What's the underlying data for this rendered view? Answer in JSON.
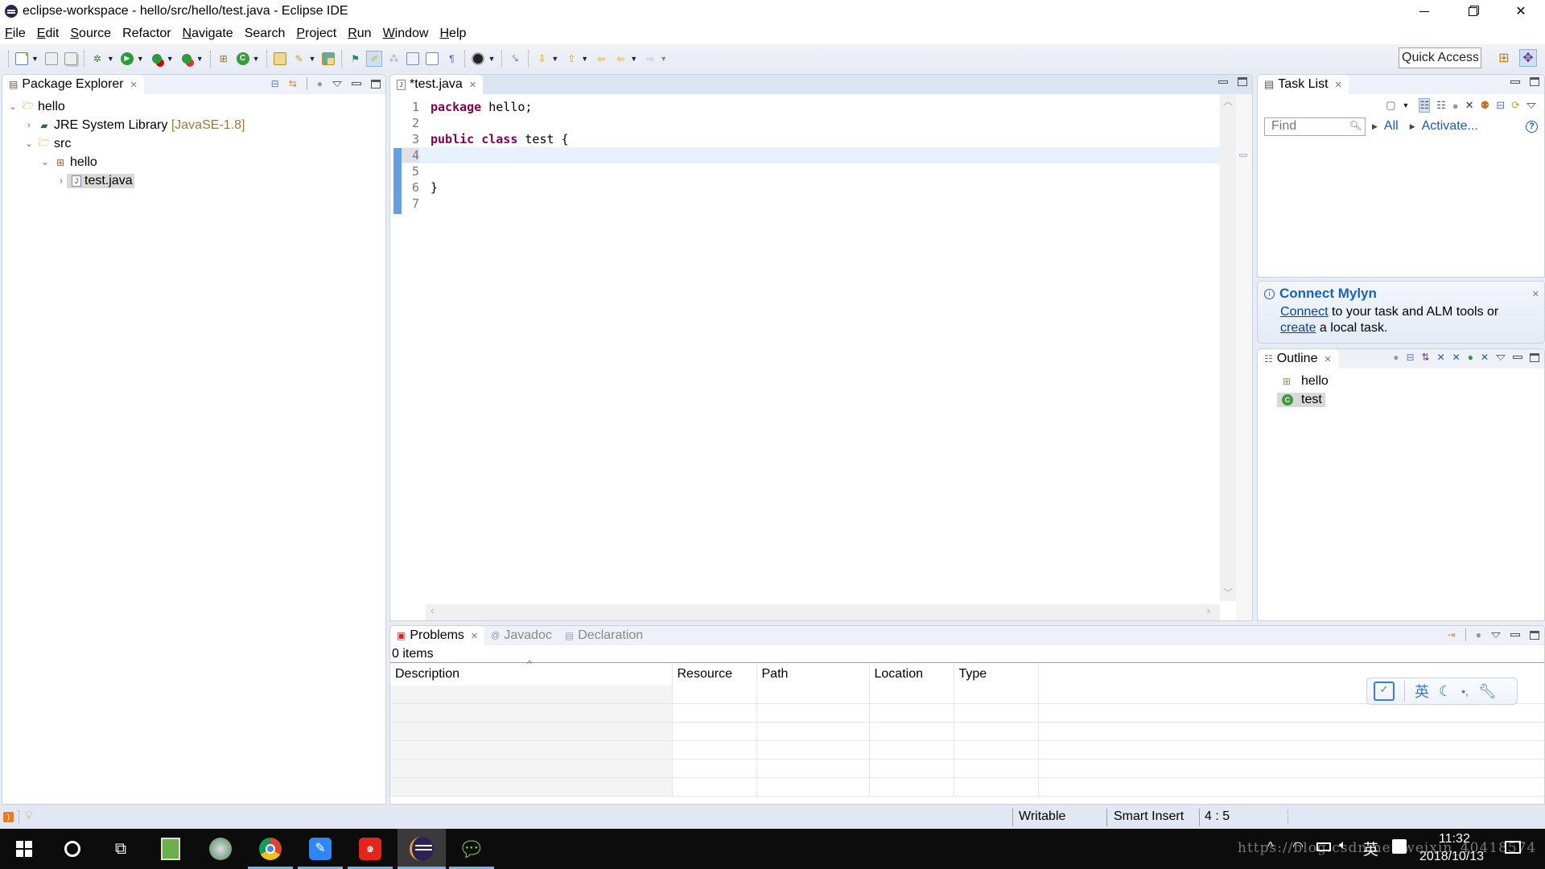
{
  "window": {
    "title": "eclipse-workspace - hello/src/hello/test.java - Eclipse IDE",
    "controls": {
      "minimize": "—",
      "restore": "❐",
      "close": "✕"
    }
  },
  "menu": [
    {
      "label": "File",
      "mnemonic": "F",
      "rest": "ile"
    },
    {
      "label": "Edit",
      "mnemonic": "E",
      "rest": "dit"
    },
    {
      "label": "Source",
      "mnemonic": "S",
      "rest": "ource"
    },
    {
      "label": "Refactor",
      "mnemonic": "",
      "rest": "Refactor"
    },
    {
      "label": "Navigate",
      "mnemonic": "N",
      "rest": "avigate"
    },
    {
      "label": "Search",
      "mnemonic": "",
      "rest": "Search"
    },
    {
      "label": "Project",
      "mnemonic": "P",
      "rest": "roject"
    },
    {
      "label": "Run",
      "mnemonic": "R",
      "rest": "un"
    },
    {
      "label": "Window",
      "mnemonic": "W",
      "rest": "indow"
    },
    {
      "label": "Help",
      "mnemonic": "H",
      "rest": "elp"
    }
  ],
  "toolbar": {
    "quick_access": "Quick Access",
    "icons": [
      "new-icon",
      "save-icon",
      "save-all-icon",
      "debug-icon",
      "run-icon",
      "coverage-icon",
      "external-tools-icon",
      "new-java-package-icon",
      "new-java-class-icon",
      "open-type-icon",
      "search-icon",
      "open-task-icon",
      "toggle-ant-editor-icon",
      "toggle-mark-occurrences-icon",
      "toggle-block-selection-icon",
      "show-whitespace-icon",
      "show-paragraph-icon",
      "user-icon",
      "skip-breakpoints-icon",
      "next-annotation-icon",
      "previous-annotation-icon",
      "last-edit-icon",
      "back-icon",
      "forward-icon"
    ]
  },
  "package_explorer": {
    "title": "Package Explorer",
    "tree": [
      {
        "label": "hello",
        "depth": 0,
        "expanded": true,
        "icon": "project-icon"
      },
      {
        "label": "JRE System Library",
        "decoration": "[JavaSE-1.8]",
        "depth": 1,
        "expanded": false,
        "icon": "library-icon"
      },
      {
        "label": "src",
        "depth": 1,
        "expanded": true,
        "icon": "source-folder-icon"
      },
      {
        "label": "hello",
        "depth": 2,
        "expanded": true,
        "icon": "package-icon"
      },
      {
        "label": "test.java",
        "depth": 3,
        "expanded": false,
        "icon": "java-file-icon",
        "selected": true
      }
    ]
  },
  "editor": {
    "tab_label": "*test.java",
    "lines": [
      {
        "n": "1",
        "tokens": [
          {
            "t": "package",
            "kw": true
          },
          {
            "t": " hello;",
            "kw": false
          }
        ]
      },
      {
        "n": "2",
        "tokens": []
      },
      {
        "n": "3",
        "tokens": [
          {
            "t": "public",
            "kw": true
          },
          {
            "t": " ",
            "kw": false
          },
          {
            "t": "class",
            "kw": true
          },
          {
            "t": " test {",
            "kw": false
          }
        ]
      },
      {
        "n": "4",
        "tokens": [],
        "current": true
      },
      {
        "n": "5",
        "tokens": []
      },
      {
        "n": "6",
        "tokens": [
          {
            "t": "}",
            "kw": false
          }
        ]
      },
      {
        "n": "7",
        "tokens": []
      }
    ]
  },
  "task_list": {
    "title": "Task List",
    "find_placeholder": "Find",
    "all_label": "All",
    "activate_label": "Activate..."
  },
  "mylyn": {
    "title": "Connect Mylyn",
    "connect_link": "Connect",
    "text1": " to your task and ALM tools or",
    "create_link": "create",
    "text2": " a local task."
  },
  "outline": {
    "title": "Outline",
    "items": [
      {
        "label": "hello",
        "icon": "package-icon"
      },
      {
        "label": "test",
        "icon": "class-icon",
        "selected": true
      }
    ]
  },
  "problems": {
    "tabs": [
      {
        "label": "Problems",
        "active": true
      },
      {
        "label": "Javadoc",
        "active": false
      },
      {
        "label": "Declaration",
        "active": false
      }
    ],
    "count": "0 items",
    "columns": [
      "Description",
      "Resource",
      "Path",
      "Location",
      "Type"
    ]
  },
  "ime": {
    "lang": "英"
  },
  "statusbar": {
    "writable": "Writable",
    "insert_mode": "Smart Insert",
    "position": "4 : 5"
  },
  "taskbar": {
    "apps": [
      "start",
      "cortana",
      "task-view",
      "notepad-plus",
      "network-app",
      "chrome",
      "feishu",
      "netease-music",
      "eclipse",
      "wechat"
    ],
    "time": "11:32",
    "date": "2018/10/13",
    "ime": "英",
    "watermark": "https://blog.csdn.net/weixin_40418574"
  },
  "colors": {
    "keyword": "#7f0055",
    "link": "#0645ad",
    "mylyn_title": "#1565c0",
    "accent": "#4a8fd8"
  }
}
